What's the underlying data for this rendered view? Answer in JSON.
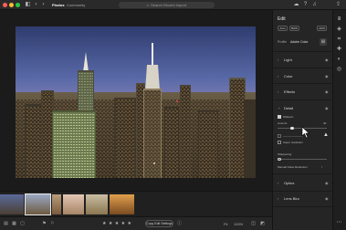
{
  "titlebar": {
    "tabs": [
      {
        "label": "Photos"
      },
      {
        "label": "Community"
      }
    ],
    "search_placeholder": "Search Recent Import",
    "traffic_colors": [
      "#ff5f57",
      "#febc2e",
      "#28c840"
    ]
  },
  "bottombar": {
    "stars": "★ ★ ★ ★ ★",
    "copy_label": "Copy Edit Settings",
    "fit_label": "Fit",
    "zoom_label": "100%"
  },
  "panel": {
    "title": "Edit",
    "profile_buttons": [
      {
        "label": "Auto"
      },
      {
        "label": "B&W"
      },
      {
        "label": "HDR"
      }
    ],
    "profile_label": "Profile",
    "profile_value": "Adobe Color",
    "sections": [
      {
        "label": "Light"
      },
      {
        "label": "Color"
      },
      {
        "label": "Effects"
      },
      {
        "label": "Detail"
      },
      {
        "label": "Optics"
      },
      {
        "label": "Lens Blur"
      }
    ],
    "detail": {
      "sharpen_label": "Sharpen",
      "amount_label": "Amount",
      "amount_value": "40",
      "super_resolution_label": "Super resolution",
      "sharpening_label": "Sharpening",
      "noise_reduction_label": "Manual Noise Reduction"
    }
  },
  "icons": {
    "sidebar_toggle": "sidebar-toggle-icon",
    "back": "chevron-left-icon",
    "forward": "chevron-right-icon",
    "search": "search-icon",
    "grid": "grid-icon",
    "cloud": "cloud-icon",
    "help": "help-icon",
    "notifications": "bell-icon",
    "share": "share-icon",
    "edit": "sliders-icon",
    "crop": "crop-icon",
    "heal": "healing-icon",
    "masking": "masking-icon",
    "redeye": "eye-icon",
    "presets": "presets-icon",
    "more": "more-icon"
  }
}
